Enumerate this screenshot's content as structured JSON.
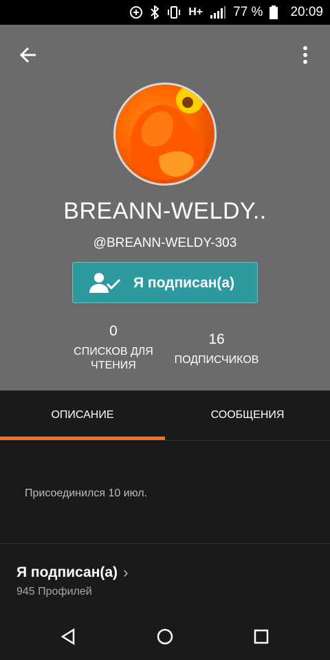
{
  "status_bar": {
    "network": "H+",
    "battery_percent": "77 %",
    "time": "20:09"
  },
  "profile": {
    "display_name": "BREANN-WELDY..",
    "handle": "@BREANN-WELDY-303",
    "follow_button": "Я подписан(а)",
    "stats": [
      {
        "value": "0",
        "label": "СПИСКОВ ДЛЯ ЧТЕНИЯ"
      },
      {
        "value": "16",
        "label": "ПОДПИСЧИКОВ"
      }
    ]
  },
  "tabs": [
    {
      "label": "ОПИСАНИЕ",
      "active": true
    },
    {
      "label": "СООБЩЕНИЯ",
      "active": false
    }
  ],
  "about": {
    "joined": "Присоединился 10 июл."
  },
  "following_section": {
    "title": "Я подписан(а)",
    "count": "945 Профилей"
  },
  "colors": {
    "header_bg": "#6b6a6c",
    "accent": "#ff6a1f",
    "button": "#2e9aa0",
    "background": "#1a191c"
  },
  "icons": {
    "back": "arrow-left-icon",
    "menu": "more-vertical-icon",
    "follow": "user-check-icon",
    "nav_back": "triangle-back-icon",
    "nav_home": "circle-home-icon",
    "nav_recent": "square-recent-icon"
  }
}
